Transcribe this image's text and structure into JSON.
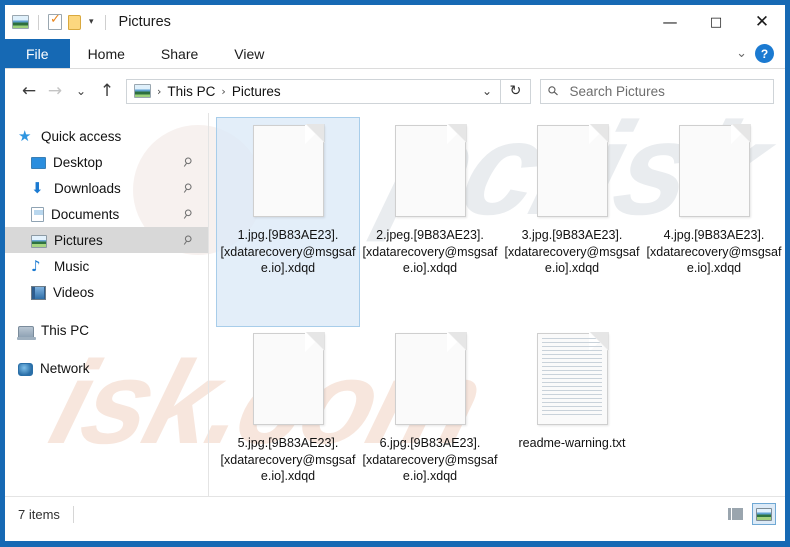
{
  "window": {
    "title": "Pictures",
    "frame_color": "#1669b4",
    "accent_color": "#1669b4",
    "quick_access": [
      {
        "name": "pictures-icon",
        "label": "Pictures"
      },
      {
        "name": "properties-icon",
        "label": "Properties"
      },
      {
        "name": "new-folder-icon",
        "label": "New folder"
      },
      {
        "name": "customize-chevron-icon",
        "label": "▾"
      }
    ],
    "controls": {
      "minimize": "—",
      "maximize": "□",
      "close": "✕"
    }
  },
  "ribbon": {
    "tabs": [
      {
        "label": "File",
        "active": true
      },
      {
        "label": "Home",
        "active": false
      },
      {
        "label": "Share",
        "active": false
      },
      {
        "label": "View",
        "active": false
      }
    ],
    "expand_chevron": "⌄",
    "help_label": "?"
  },
  "navigation": {
    "back": "←",
    "forward": "→",
    "recent": "⌄",
    "up": "↑",
    "breadcrumbs": [
      "This PC",
      "Pictures"
    ],
    "breadcrumb_separator": "›",
    "path_dropdown": "⌄",
    "refresh": "↻"
  },
  "search": {
    "placeholder": "Search Pictures",
    "value": "",
    "icon": "search-icon"
  },
  "sidebar": {
    "items": [
      {
        "label": "Quick access",
        "icon": "star-icon",
        "indent": "root",
        "pinned": false,
        "selected": false
      },
      {
        "label": "Desktop",
        "icon": "desktop-icon",
        "indent": "child",
        "pinned": true,
        "selected": false
      },
      {
        "label": "Downloads",
        "icon": "download-icon",
        "indent": "child",
        "pinned": true,
        "selected": false
      },
      {
        "label": "Documents",
        "icon": "document-icon",
        "indent": "child",
        "pinned": true,
        "selected": false
      },
      {
        "label": "Pictures",
        "icon": "pictures-icon",
        "indent": "child",
        "pinned": true,
        "selected": true
      },
      {
        "label": "Music",
        "icon": "music-icon",
        "indent": "child",
        "pinned": false,
        "selected": false
      },
      {
        "label": "Videos",
        "icon": "video-icon",
        "indent": "child",
        "pinned": false,
        "selected": false
      },
      {
        "label": "This PC",
        "icon": "this-pc-icon",
        "indent": "root",
        "pinned": false,
        "selected": false
      },
      {
        "label": "Network",
        "icon": "network-icon",
        "indent": "root",
        "pinned": false,
        "selected": false
      }
    ],
    "pin_glyph": "📌"
  },
  "files": [
    {
      "name": "1.jpg.[9B83AE23].[xdatarecovery@msgsafe.io].xdqd",
      "icon": "blank-file-icon",
      "selected": true
    },
    {
      "name": "2.jpeg.[9B83AE23].[xdatarecovery@msgsafe.io].xdqd",
      "icon": "blank-file-icon",
      "selected": false
    },
    {
      "name": "3.jpg.[9B83AE23].[xdatarecovery@msgsafe.io].xdqd",
      "icon": "blank-file-icon",
      "selected": false
    },
    {
      "name": "4.jpg.[9B83AE23].[xdatarecovery@msgsafe.io].xdqd",
      "icon": "blank-file-icon",
      "selected": false
    },
    {
      "name": "5.jpg.[9B83AE23].[xdatarecovery@msgsafe.io].xdqd",
      "icon": "blank-file-icon",
      "selected": false
    },
    {
      "name": "6.jpg.[9B83AE23].[xdatarecovery@msgsafe.io].xdqd",
      "icon": "blank-file-icon",
      "selected": false
    },
    {
      "name": "readme-warning.txt",
      "icon": "text-file-icon",
      "selected": false
    }
  ],
  "status": {
    "item_count_text": "7 items",
    "view_buttons": [
      {
        "name": "details-view-button",
        "active": false
      },
      {
        "name": "large-icons-view-button",
        "active": true
      }
    ]
  },
  "watermarks": {
    "top_text": "pcrisk",
    "bottom_text": "isk.com"
  }
}
